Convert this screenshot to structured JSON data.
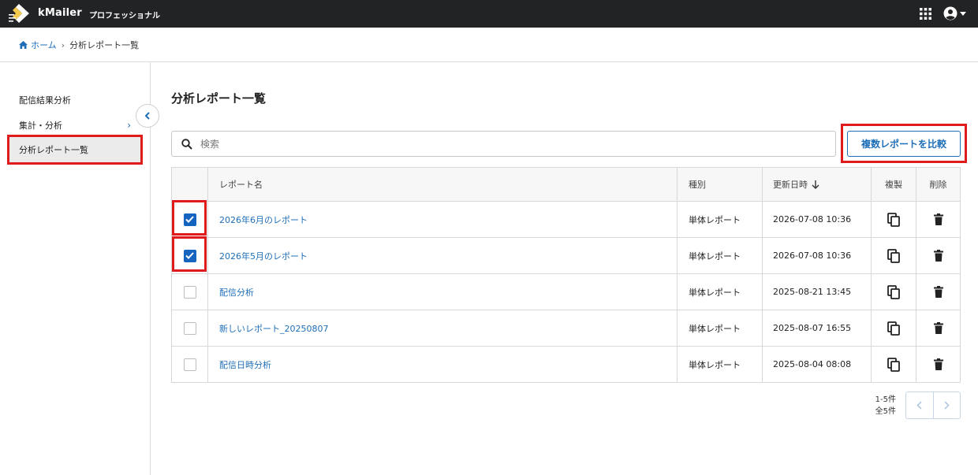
{
  "app": {
    "brand": "kMailer",
    "edition": "プロフェッショナル"
  },
  "breadcrumb": {
    "home": "ホーム",
    "current": "分析レポート一覧"
  },
  "sidebar": {
    "items": [
      {
        "label": "配信結果分析"
      },
      {
        "label": "集計・分析"
      },
      {
        "label": "分析レポート一覧"
      }
    ]
  },
  "main": {
    "title": "分析レポート一覧",
    "search_placeholder": "検索",
    "compare_button": "複数レポートを比較"
  },
  "table": {
    "headers": {
      "name": "レポート名",
      "type": "種別",
      "updated": "更新日時",
      "copy": "複製",
      "delete": "削除"
    },
    "rows": [
      {
        "name": "2026年6月のレポート",
        "type": "単体レポート",
        "updated": "2026-07-08 10:36",
        "checked": true
      },
      {
        "name": "2026年5月のレポート",
        "type": "単体レポート",
        "updated": "2026-07-08 10:36",
        "checked": true
      },
      {
        "name": "配信分析",
        "type": "単体レポート",
        "updated": "2025-08-21 13:45",
        "checked": false
      },
      {
        "name": "新しいレポート_20250807",
        "type": "単体レポート",
        "updated": "2025-08-07 16:55",
        "checked": false
      },
      {
        "name": "配信日時分析",
        "type": "単体レポート",
        "updated": "2025-08-04 08:08",
        "checked": false
      }
    ]
  },
  "pagination": {
    "range": "1-5件",
    "total": "全5件"
  },
  "colors": {
    "topbar": "#222325",
    "accent": "#1f6fb8",
    "highlight": "#e01b1b",
    "checkbox": "#1565c0"
  }
}
